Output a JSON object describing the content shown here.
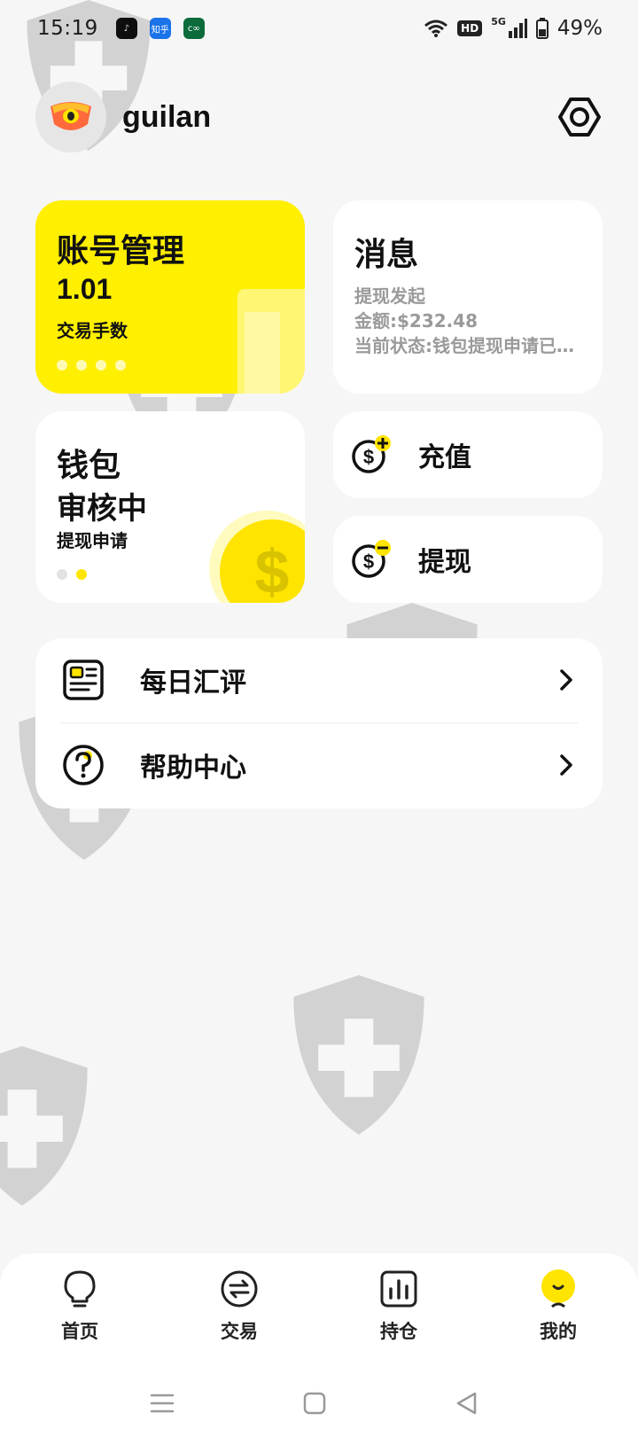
{
  "status_bar": {
    "time": "15:19",
    "apps": [
      {
        "icon": "tiktok-icon",
        "label": "♪",
        "color": "#111111"
      },
      {
        "icon": "zhihu-icon",
        "label": "知乎",
        "color": "#1a73e8"
      },
      {
        "icon": "app-icon",
        "label": "c∞",
        "color": "#0c6b3a"
      }
    ],
    "network": "5G",
    "hd": "HD",
    "battery": "49%"
  },
  "header": {
    "username": "guilan",
    "avatar_icon": "avatar-eye-icon",
    "settings_icon": "settings-hex-icon"
  },
  "cards": {
    "account": {
      "title": "账号管理",
      "value": "1.01",
      "subtitle": "交易手数",
      "color": "#ffef00"
    },
    "message": {
      "title": "消息",
      "lines": [
        "提现发起",
        "金额:$232.48",
        "当前状态:钱包提现申请已提交"
      ]
    },
    "wallet": {
      "title": "钱包",
      "status": "审核中",
      "subtitle": "提现申请",
      "coin": "$"
    },
    "deposit": {
      "label": "充值",
      "icon": "coin-plus-icon"
    },
    "withdraw": {
      "label": "提现",
      "icon": "coin-minus-icon"
    }
  },
  "menu": [
    {
      "label": "每日汇评",
      "icon": "news-icon"
    },
    {
      "label": "帮助中心",
      "icon": "help-icon"
    }
  ],
  "bottom_nav": [
    {
      "label": "首页",
      "icon": "bulb-icon",
      "active": false
    },
    {
      "label": "交易",
      "icon": "exchange-icon",
      "active": false
    },
    {
      "label": "持仓",
      "icon": "chart-icon",
      "active": false
    },
    {
      "label": "我的",
      "icon": "profile-icon",
      "active": true
    }
  ],
  "accent_color": "#ffe400"
}
